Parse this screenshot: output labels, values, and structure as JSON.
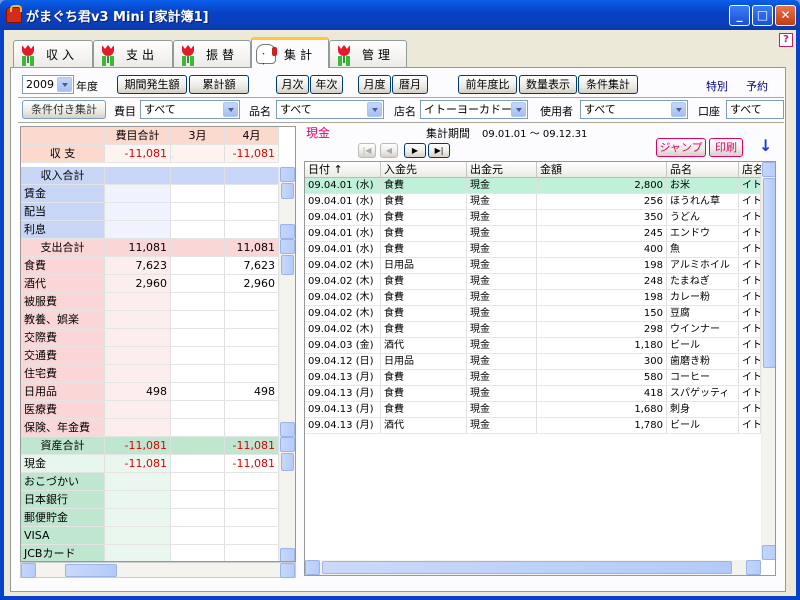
{
  "window": {
    "title": "がまぐち君v3 Mini [家計簿1]",
    "help_label": "?"
  },
  "tabs": [
    {
      "label": "収入",
      "icon": "tulip-icon"
    },
    {
      "label": "支出",
      "icon": "tulip-icon"
    },
    {
      "label": "振替",
      "icon": "tulip-icon"
    },
    {
      "label": "集計",
      "icon": "maneki-cat-icon",
      "active": true
    },
    {
      "label": "管理",
      "icon": "tulip-icon"
    }
  ],
  "toolbar": {
    "year_value": "2009",
    "year_label": "年度",
    "period_amount": "期間発生額",
    "cumulative": "累計額",
    "monthly": "月次",
    "yearly": "年次",
    "fiscal_month": "月度",
    "calendar_month": "暦月",
    "prev_year_compare": "前年度比",
    "quantity_display": "数量表示",
    "condition_total": "条件集計",
    "special": "特別",
    "reservation": "予約"
  },
  "filters": {
    "conditional_total": "条件付き集計",
    "expense_item_label": "費目",
    "expense_item_value": "すべて",
    "product_label": "品名",
    "product_value": "すべて",
    "store_label": "店名",
    "store_value": "イトーヨーカドー",
    "user_label": "使用者",
    "user_value": "すべて",
    "account_label": "口座",
    "account_value": "すべて"
  },
  "left_grid": {
    "header": {
      "total": "費目合計",
      "mar": "3月",
      "apr": "4月"
    },
    "balance": {
      "label": "収 支",
      "total": "-11,081",
      "mar": "",
      "apr": "-11,081"
    },
    "income": {
      "title": "収入合計",
      "items": [
        "賃金",
        "配当",
        "利息"
      ]
    },
    "expense": {
      "title": "支出合計",
      "total": "11,081",
      "apr": "11,081",
      "items": [
        {
          "label": "食費",
          "total": "7,623",
          "apr": "7,623"
        },
        {
          "label": "酒代",
          "total": "2,960",
          "apr": "2,960"
        },
        {
          "label": "被服費",
          "total": "",
          "apr": ""
        },
        {
          "label": "教養、娯楽",
          "total": "",
          "apr": ""
        },
        {
          "label": "交際費",
          "total": "",
          "apr": ""
        },
        {
          "label": "交通費",
          "total": "",
          "apr": ""
        },
        {
          "label": "住宅費",
          "total": "",
          "apr": ""
        },
        {
          "label": "日用品",
          "total": "498",
          "apr": "498"
        },
        {
          "label": "医療費",
          "total": "",
          "apr": ""
        },
        {
          "label": "保険、年金費",
          "total": "",
          "apr": ""
        }
      ]
    },
    "assets": {
      "title": "資産合計",
      "total": "-11,081",
      "apr": "-11,081",
      "items": [
        {
          "label": "現金",
          "total": "-11,081",
          "apr": "-11,081"
        },
        {
          "label": "おこづかい",
          "total": "",
          "apr": ""
        },
        {
          "label": "日本銀行",
          "total": "",
          "apr": ""
        },
        {
          "label": "郵便貯金",
          "total": "",
          "apr": ""
        },
        {
          "label": "VISA",
          "total": "",
          "apr": ""
        },
        {
          "label": "JCBカード",
          "total": "",
          "apr": ""
        }
      ]
    }
  },
  "right_panel": {
    "account_title": "現金",
    "period_label": "集計期間",
    "period_value": "09.01.01 ～ 09.12.31",
    "jump": "ジャンプ",
    "print": "印刷",
    "down_arrow": "↓",
    "columns": [
      "日付 ↑",
      "入金先",
      "出金元",
      "金額",
      "品名",
      "店名"
    ],
    "rows": [
      {
        "date": "09.04.01 (水)",
        "in": "食費",
        "out": "現金",
        "amount": "2,800",
        "item": "お米",
        "store": "イト"
      },
      {
        "date": "09.04.01 (水)",
        "in": "食費",
        "out": "現金",
        "amount": "256",
        "item": "ほうれん草",
        "store": "イト"
      },
      {
        "date": "09.04.01 (水)",
        "in": "食費",
        "out": "現金",
        "amount": "350",
        "item": "うどん",
        "store": "イト"
      },
      {
        "date": "09.04.01 (水)",
        "in": "食費",
        "out": "現金",
        "amount": "245",
        "item": "エンドウ",
        "store": "イト"
      },
      {
        "date": "09.04.01 (水)",
        "in": "食費",
        "out": "現金",
        "amount": "400",
        "item": "魚",
        "store": "イト"
      },
      {
        "date": "09.04.02 (木)",
        "in": "日用品",
        "out": "現金",
        "amount": "198",
        "item": "アルミホイル",
        "store": "イト"
      },
      {
        "date": "09.04.02 (木)",
        "in": "食費",
        "out": "現金",
        "amount": "248",
        "item": "たまねぎ",
        "store": "イト"
      },
      {
        "date": "09.04.02 (木)",
        "in": "食費",
        "out": "現金",
        "amount": "198",
        "item": "カレー粉",
        "store": "イト"
      },
      {
        "date": "09.04.02 (木)",
        "in": "食費",
        "out": "現金",
        "amount": "150",
        "item": "豆腐",
        "store": "イト"
      },
      {
        "date": "09.04.02 (木)",
        "in": "食費",
        "out": "現金",
        "amount": "298",
        "item": "ウインナー",
        "store": "イト"
      },
      {
        "date": "09.04.03 (金)",
        "in": "酒代",
        "out": "現金",
        "amount": "1,180",
        "item": "ビール",
        "store": "イト"
      },
      {
        "date": "09.04.12 (日)",
        "in": "日用品",
        "out": "現金",
        "amount": "300",
        "item": "歯磨き粉",
        "store": "イト"
      },
      {
        "date": "09.04.13 (月)",
        "in": "食費",
        "out": "現金",
        "amount": "580",
        "item": "コーヒー",
        "store": "イト"
      },
      {
        "date": "09.04.13 (月)",
        "in": "食費",
        "out": "現金",
        "amount": "418",
        "item": "スパゲッティ",
        "store": "イト"
      },
      {
        "date": "09.04.13 (月)",
        "in": "食費",
        "out": "現金",
        "amount": "1,680",
        "item": "刺身",
        "store": "イト"
      },
      {
        "date": "09.04.13 (月)",
        "in": "酒代",
        "out": "現金",
        "amount": "1,780",
        "item": "ビール",
        "store": "イト"
      }
    ]
  },
  "colors": {
    "header_peach": "#fbd9cc",
    "income_blue": "#c7d6f6",
    "expense_pink": "#fbd6d6",
    "asset_green": "#bfe6cf",
    "negative_red": "#e00000",
    "selected_row": "#bff0d8"
  }
}
